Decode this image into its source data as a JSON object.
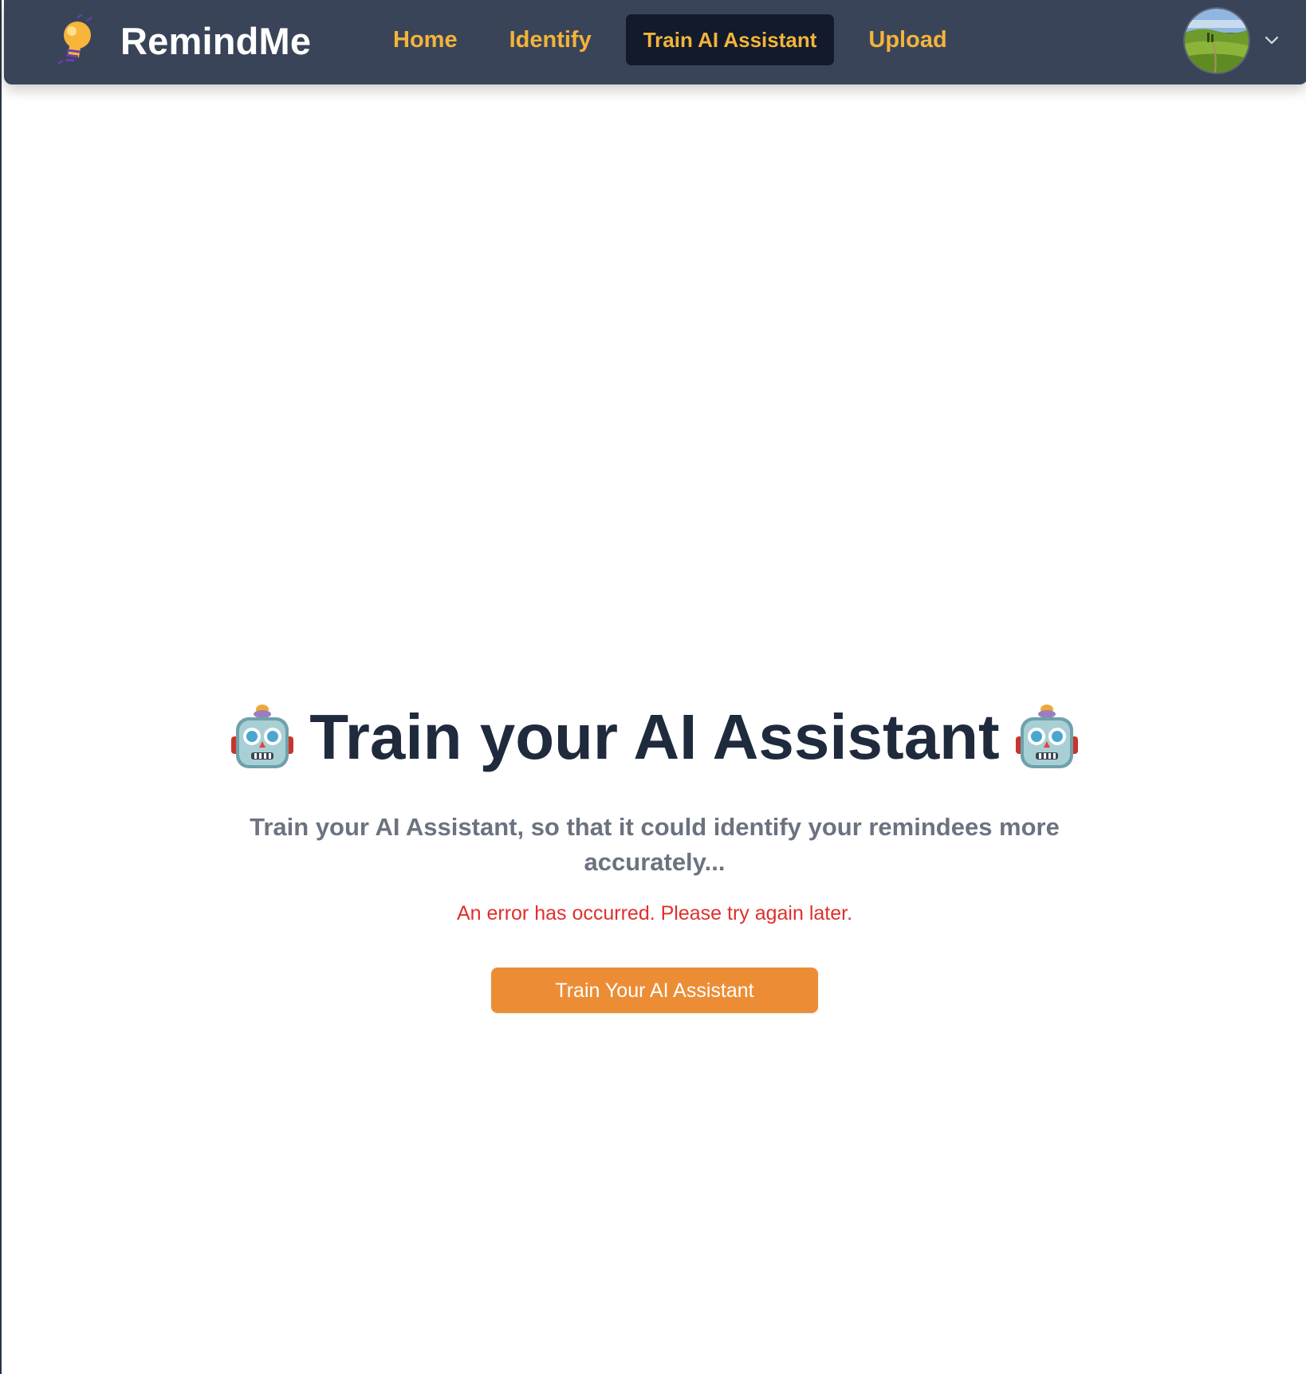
{
  "app": {
    "name": "RemindMe",
    "logo_icon": "lightbulb-icon"
  },
  "nav": {
    "items": [
      {
        "label": "Home",
        "active": false
      },
      {
        "label": "Identify",
        "active": false
      },
      {
        "label": "Train AI Assistant",
        "active": true
      },
      {
        "label": "Upload",
        "active": false
      }
    ]
  },
  "user_menu": {
    "avatar_icon": "avatar-landscape-photo",
    "dropdown_icon": "chevron-down-icon"
  },
  "hero": {
    "title": "Train your AI Assistant",
    "title_icon": "robot-icon",
    "subtitle": "Train your AI Assistant, so that it could identify your remindees more accurately...",
    "error_message": "An error has occurred. Please try again later.",
    "button_label": "Train Your AI Assistant"
  },
  "colors": {
    "navbar_bg": "#3a4458",
    "nav_link": "#f2b43a",
    "nav_active_bg": "#121a2b",
    "title": "#1f2a3d",
    "subtitle": "#6b7380",
    "error": "#e0302c",
    "button_bg": "#ec8d35"
  }
}
